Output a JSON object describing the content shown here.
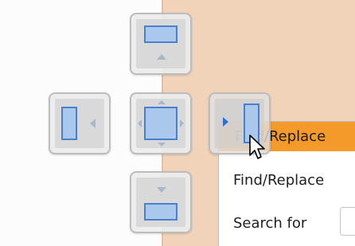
{
  "dialog": {
    "title": "Find/Replace",
    "lines": [
      "Find/Replace",
      "Search for"
    ],
    "search_input_value": ""
  },
  "dock_guide": {
    "buttons": [
      {
        "name": "dock-top-button",
        "icon": "dock-top-icon"
      },
      {
        "name": "dock-left-button",
        "icon": "dock-left-icon"
      },
      {
        "name": "dock-center-button",
        "icon": "dock-center-icon"
      },
      {
        "name": "dock-right-button",
        "icon": "dock-right-icon",
        "state": "hovered"
      },
      {
        "name": "dock-bottom-button",
        "icon": "dock-bottom-icon"
      }
    ]
  },
  "colors": {
    "title_bar": "#f39a2b",
    "dock_preview_area": "#f0d3b8",
    "dock_pane_fill": "#aac8ec",
    "dock_pane_border": "#4b80d0",
    "active_arrow": "#2f6fd6"
  },
  "cursor": {
    "icon": "mouse-pointer-icon"
  }
}
